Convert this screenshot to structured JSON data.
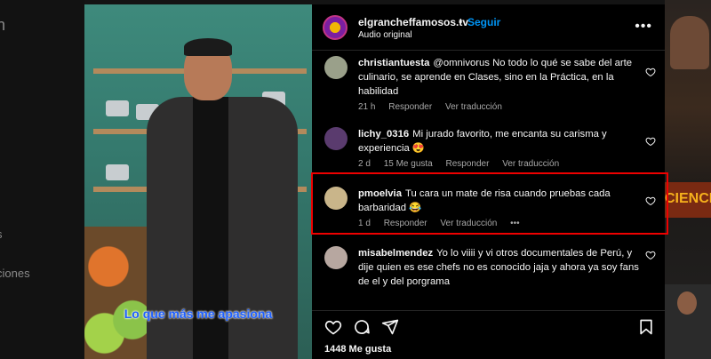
{
  "background": {
    "left_fragments": [
      "n",
      "s",
      "ciones"
    ],
    "right_sign": "CIENCIA"
  },
  "video": {
    "caption": "Lo que más me apasiona"
  },
  "header": {
    "username": "elgrancheffamosos.tv",
    "separator": "•",
    "follow_label": "Seguir",
    "audio": "Audio original",
    "more": "•••"
  },
  "comments": [
    {
      "user": "christiantuesta",
      "text": "@omnivorus No todo lo qué se sabe del arte culinario, se aprende en Clases, sino en la Práctica, en la habilidad",
      "time": "21 h",
      "likes": "",
      "reply": "Responder",
      "translate": "Ver traducción",
      "avatar_color": "#9aa08a"
    },
    {
      "user": "lichy_0316",
      "text": "Mi jurado favorito, me encanta su carisma y experiencia 😍",
      "time": "2 d",
      "likes": "15 Me gusta",
      "reply": "Responder",
      "translate": "Ver traducción",
      "avatar_color": "#5a3b6e"
    },
    {
      "user": "pmoelvia",
      "text": "Tu cara un mate de risa cuando pruebas cada barbaridad 😂",
      "time": "1 d",
      "likes": "",
      "reply": "Responder",
      "translate": "Ver traducción",
      "more": "•••",
      "avatar_color": "#c9b58a"
    },
    {
      "user": "misabelmendez",
      "text": "Yo lo viiii y vi otros documentales de Perú, y dije quien es ese chefs no es conocido jaja y ahora ya soy fans de el y del porgrama",
      "time": "",
      "likes": "",
      "reply": "",
      "translate": "",
      "avatar_color": "#b7a7a0"
    }
  ],
  "post": {
    "likes": "1448 Me gusta"
  },
  "colors": {
    "accent": "#0095f6",
    "highlight": "#e00000",
    "caption": "#1e60ff"
  }
}
